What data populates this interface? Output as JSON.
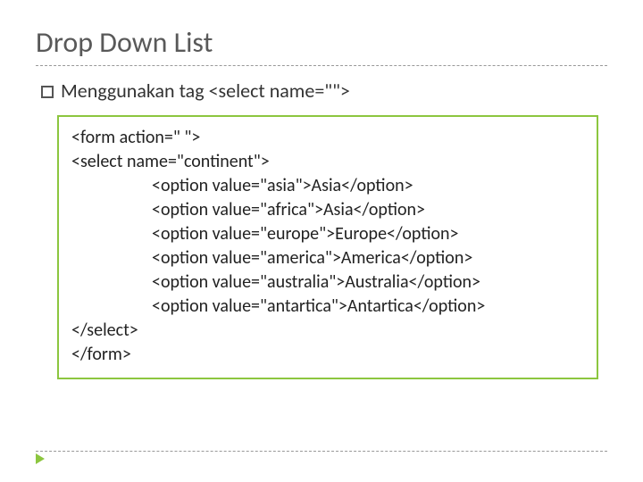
{
  "title": "Drop Down List",
  "sub_prefix": "Menggunakan tag ",
  "sub_tag": "<select name=\"\">",
  "code": {
    "l1": "<form action=\" \">",
    "l2": "<select name=\"continent\">",
    "l3": "<option value=\"asia\">Asia</option>",
    "l4": "<option value=\"africa\">Asia</option>",
    "l5": "<option value=\"europe\">Europe</option>",
    "l6": "<option value=\"america\">America</option>",
    "l7": "<option value=\"australia\">Australia</option>",
    "l8": "<option value=\"antartica\">Antartica</option>",
    "l9": "</select>",
    "l10": "</form>"
  }
}
